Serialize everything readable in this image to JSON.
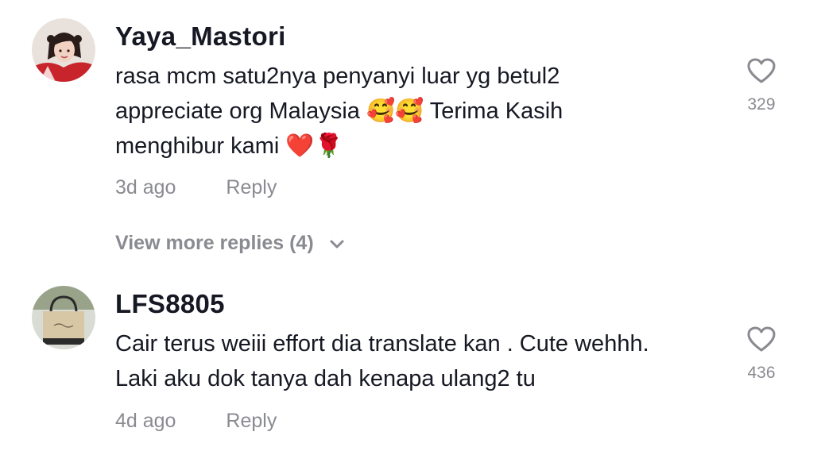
{
  "comments": [
    {
      "username": "Yaya_Mastori",
      "text": "rasa mcm satu2nya penyanyi luar yg betul2\nappreciate org Malaysia 🥰🥰 Terima Kasih\nmenghibur kami ❤️🌹",
      "time": "3d ago",
      "reply_label": "Reply",
      "likes": "329",
      "avatar_icon": "user-avatar-girl"
    },
    {
      "username": "LFS8805",
      "text": "Cair terus weiii effort dia translate kan . Cute wehhh.\nLaki aku dok tanya dah kenapa ulang2 tu",
      "time": "4d ago",
      "reply_label": "Reply",
      "likes": "436",
      "avatar_icon": "tote-bag-avatar"
    }
  ],
  "view_more_replies": "View more replies (4)"
}
